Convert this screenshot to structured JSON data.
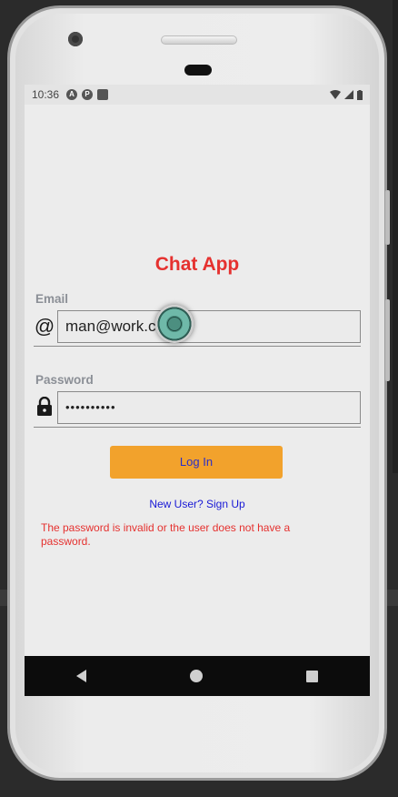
{
  "status": {
    "time": "10:36"
  },
  "app": {
    "title": "Chat App"
  },
  "form": {
    "email_label": "Email",
    "email_value": "man@work.com",
    "password_label": "Password",
    "password_value": "••••••••••",
    "login_label": "Log In",
    "signup_label": "New User? Sign Up",
    "error_text": "The password is invalid or the user does not have a password."
  },
  "icons": {
    "email": "at-icon",
    "password": "lock-icon",
    "nav_back": "back-icon",
    "nav_home": "home-icon",
    "nav_recents": "recents-icon"
  },
  "colors": {
    "title": "#e5312f",
    "button": "#f2a22c",
    "button_text": "#2a2fc9",
    "link": "#1919d6",
    "error": "#e5312f"
  }
}
